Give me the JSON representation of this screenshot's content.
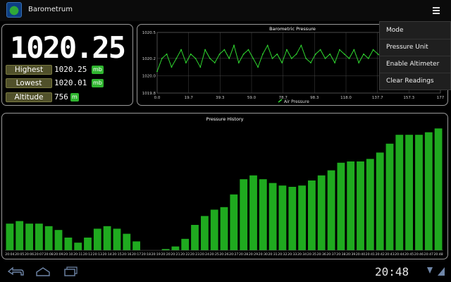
{
  "app": {
    "title": "Barometrum",
    "icon": "barometer-globe-icon"
  },
  "readout": {
    "current": "1020.25",
    "highest_label": "Highest",
    "highest_value": "1020.25",
    "highest_unit": "mb",
    "lowest_label": "Lowest",
    "lowest_value": "1020.01",
    "lowest_unit": "mb",
    "altitude_label": "Altitude",
    "altitude_value": "756",
    "altitude_unit": "m"
  },
  "menu": {
    "items": [
      "Mode",
      "Pressure Unit",
      "Enable Altimeter",
      "Clear Readings"
    ]
  },
  "system": {
    "clock": "20:48"
  },
  "colors": {
    "accent": "#2fd62f",
    "bar": "#1faa1f",
    "panel_border": "#9a9a9a",
    "label_bg": "#50502a"
  },
  "chart_data": [
    {
      "type": "line",
      "title": "Barometric Pressure",
      "legend": "Air Pressure",
      "legend_position": "bottom",
      "grid": true,
      "xlim": [
        0,
        177
      ],
      "ylim": [
        1019.8,
        1020.5
      ],
      "x_ticks": [
        "0.0",
        "19.7",
        "39.3",
        "59.0",
        "78.7",
        "98.3",
        "118.0",
        "137.7",
        "157.3",
        "177"
      ],
      "y_ticks": [
        "1020.5",
        "1020.2",
        "1020.0",
        "1019.8"
      ],
      "series": [
        {
          "name": "Air Pressure",
          "x": [
            0,
            3,
            6,
            9,
            12,
            15,
            18,
            21,
            24,
            27,
            30,
            33,
            36,
            39,
            42,
            45,
            48,
            51,
            54,
            57,
            60,
            63,
            66,
            69,
            72,
            75,
            78,
            81,
            84,
            87,
            90,
            93,
            96,
            99,
            102,
            105,
            108,
            111,
            114,
            117,
            120,
            123,
            126,
            129,
            132,
            135,
            138,
            141,
            144,
            147,
            150,
            153,
            156,
            159,
            162,
            165,
            168,
            171,
            174,
            177
          ],
          "y": [
            1020.05,
            1020.2,
            1020.25,
            1020.1,
            1020.2,
            1020.3,
            1020.15,
            1020.25,
            1020.2,
            1020.1,
            1020.3,
            1020.2,
            1020.15,
            1020.25,
            1020.3,
            1020.2,
            1020.35,
            1020.15,
            1020.25,
            1020.3,
            1020.2,
            1020.1,
            1020.25,
            1020.35,
            1020.2,
            1020.25,
            1020.15,
            1020.3,
            1020.2,
            1020.25,
            1020.35,
            1020.2,
            1020.15,
            1020.25,
            1020.3,
            1020.2,
            1020.25,
            1020.15,
            1020.3,
            1020.25,
            1020.2,
            1020.3,
            1020.15,
            1020.25,
            1020.2,
            1020.3,
            1020.25,
            1020.2,
            1020.15,
            1020.25,
            1020.3,
            1020.2,
            1020.25,
            1020.2,
            1020.15,
            1020.25,
            1020.3,
            1020.2,
            1020.25,
            1020.2
          ]
        }
      ]
    },
    {
      "type": "bar",
      "title": "Pressure History",
      "grid": false,
      "ylim": [
        0,
        100
      ],
      "categories": [
        "20:04",
        "20:05",
        "20:06",
        "20:07",
        "20:08",
        "20:09",
        "20:10",
        "20:11",
        "20:12",
        "20:13",
        "20:14",
        "20:15",
        "20:16",
        "20:17",
        "20:18",
        "20:19",
        "20:20",
        "20:21",
        "20:22",
        "20:23",
        "20:24",
        "20:25",
        "20:26",
        "20:27",
        "20:28",
        "20:29",
        "20:30",
        "20:31",
        "20:32",
        "20:33",
        "20:34",
        "20:35",
        "20:36",
        "20:37",
        "20:38",
        "20:39",
        "20:40",
        "20:41",
        "20:42",
        "20:43",
        "20:44",
        "20:45",
        "20:46",
        "20:47",
        "20:48"
      ],
      "values": [
        21,
        23,
        21,
        21,
        19,
        16,
        10,
        6,
        10,
        17,
        19,
        17,
        13,
        7,
        0,
        0,
        1,
        3,
        9,
        20,
        27,
        32,
        34,
        44,
        56,
        59,
        56,
        53,
        51,
        50,
        51,
        55,
        59,
        63,
        69,
        70,
        70,
        72,
        77,
        84,
        91,
        91,
        91,
        93,
        96
      ]
    }
  ]
}
